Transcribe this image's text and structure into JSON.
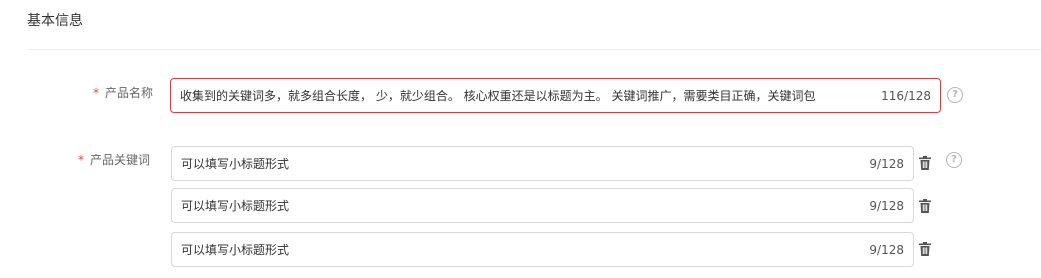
{
  "section": {
    "title": "基本信息"
  },
  "product_name": {
    "label": "产品名称",
    "required_mark": "*",
    "value": "收集到的关键词多，就多组合长度， 少，就少组合。 核心权重还是以标题为主。 关键词推广，需要类目正确，关键词包",
    "counter": "116/128",
    "state": "error"
  },
  "product_keywords": {
    "label": "产品关键词",
    "required_mark": "*",
    "items": [
      {
        "value": "可以填写小标题形式",
        "counter": "9/128"
      },
      {
        "value": "可以填写小标题形式",
        "counter": "9/128"
      },
      {
        "value": "可以填写小标题形式",
        "counter": "9/128"
      }
    ]
  },
  "icons": {
    "help": "question-circle-icon",
    "delete": "trash-icon",
    "help_glyph": "?"
  },
  "colors": {
    "required": "#f04134",
    "error_border": "#e3393c",
    "border": "#d9d9d9"
  }
}
